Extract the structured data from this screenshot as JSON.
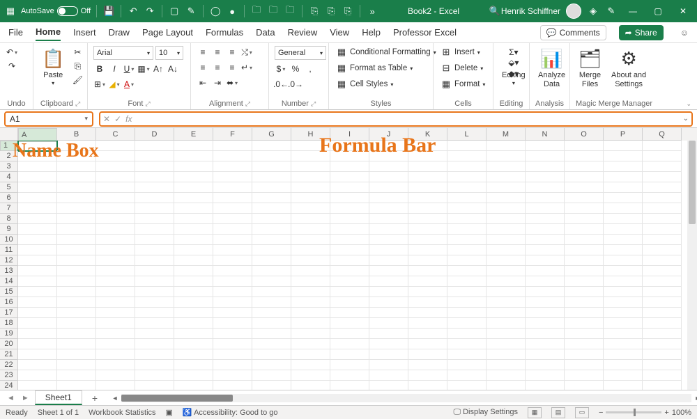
{
  "title": {
    "autosave": "AutoSave",
    "autosave_state": "Off",
    "doc": "Book2",
    "app": "Excel",
    "user": "Henrik Schiffner"
  },
  "tabs": {
    "items": [
      "File",
      "Home",
      "Insert",
      "Draw",
      "Page Layout",
      "Formulas",
      "Data",
      "Review",
      "View",
      "Help",
      "Professor Excel"
    ],
    "active": 1,
    "comments": "Comments",
    "share": "Share"
  },
  "ribbon": {
    "undo": "Undo",
    "clipboard": {
      "label": "Clipboard",
      "paste": "Paste"
    },
    "font": {
      "label": "Font",
      "name": "Arial",
      "size": "10"
    },
    "alignment": "Alignment",
    "number": {
      "label": "Number",
      "format": "General"
    },
    "styles": {
      "label": "Styles",
      "cond": "Conditional Formatting",
      "table": "Format as Table",
      "cell": "Cell Styles"
    },
    "cells": {
      "label": "Cells",
      "insert": "Insert",
      "delete": "Delete",
      "format": "Format"
    },
    "editing": "Editing",
    "analysis": {
      "label": "Analysis",
      "analyze": "Analyze\nData"
    },
    "mmm": {
      "label": "Magic Merge Manager",
      "merge": "Merge\nFiles",
      "about": "About and\nSettings"
    }
  },
  "namebox": "A1",
  "annotations": {
    "namebox": "Name Box",
    "formulabar": "Formula Bar"
  },
  "columns": [
    "A",
    "B",
    "C",
    "D",
    "E",
    "F",
    "G",
    "H",
    "I",
    "J",
    "K",
    "L",
    "M",
    "N",
    "O",
    "P",
    "Q"
  ],
  "rows": 24,
  "sheet": {
    "name": "Sheet1"
  },
  "status": {
    "ready": "Ready",
    "sheet": "Sheet 1 of 1",
    "wb": "Workbook Statistics",
    "access": "Accessibility: Good to go",
    "display": "Display Settings",
    "zoom": "100%"
  }
}
